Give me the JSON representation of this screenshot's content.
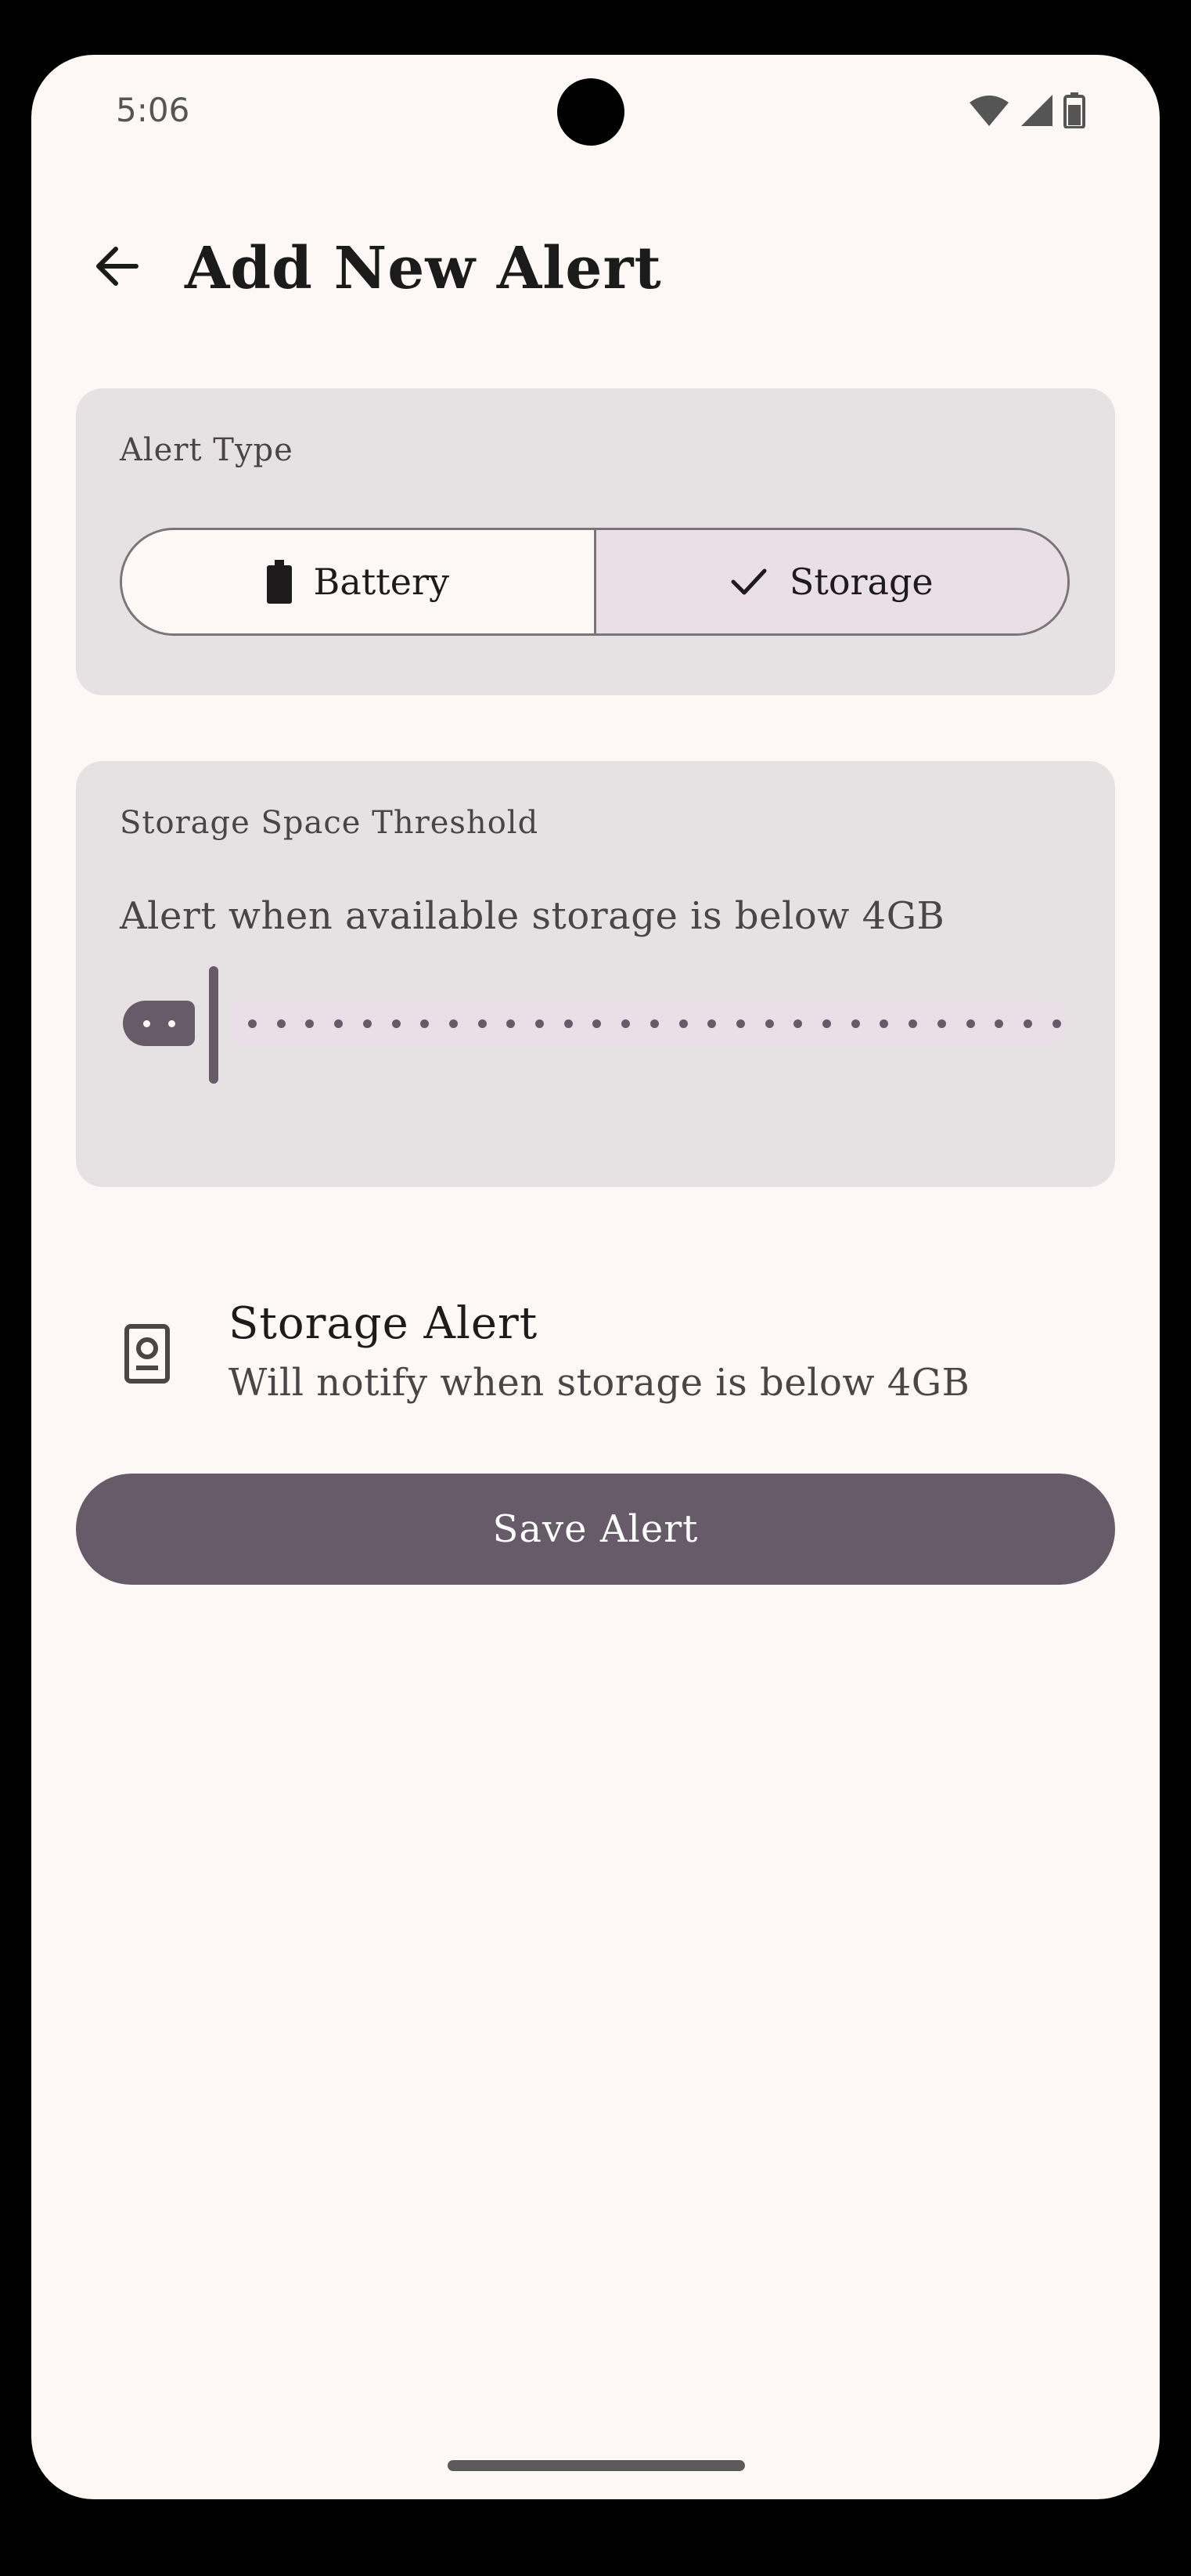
{
  "status_bar": {
    "time": "5:06",
    "icons": [
      "wifi-icon",
      "signal-icon",
      "battery-status-icon"
    ]
  },
  "header": {
    "back_icon": "arrow-back-icon",
    "title": "Add New Alert"
  },
  "alert_type": {
    "label": "Alert Type",
    "options": [
      {
        "label": "Battery",
        "icon": "battery-icon",
        "selected": false
      },
      {
        "label": "Storage",
        "icon": "check-icon",
        "selected": true
      }
    ]
  },
  "threshold": {
    "label": "Storage Space Threshold",
    "description": "Alert when available storage is below 4GB",
    "slider_value_fraction": 0.0
  },
  "summary": {
    "icon": "storage-device-icon",
    "title": "Storage Alert",
    "subtitle": "Will notify when storage is below 4GB"
  },
  "actions": {
    "save_label": "Save Alert"
  },
  "colors": {
    "primary": "#675b69",
    "surface": "#fdf7f6",
    "card": "#e6e1e3",
    "selected": "#eadfe6"
  }
}
